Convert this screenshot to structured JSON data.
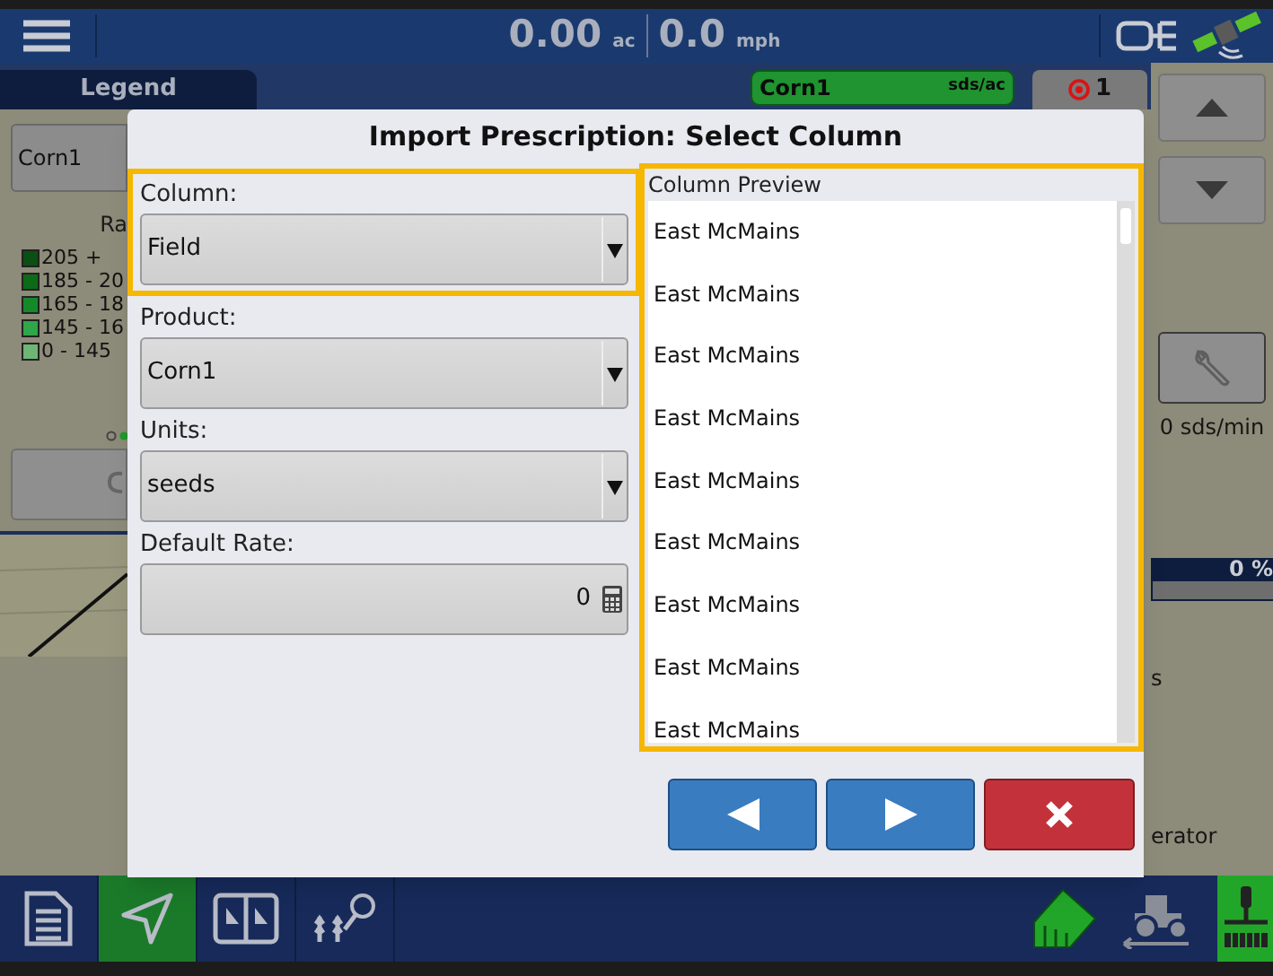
{
  "header": {
    "area_value": "0.00",
    "area_unit": "ac",
    "speed_value": "0.0",
    "speed_unit": "mph"
  },
  "legend": {
    "tab": "Legend",
    "product": "Corn1",
    "heading": "Ra",
    "ranges": [
      {
        "label": "205 +",
        "color": "#0b4f12"
      },
      {
        "label": "185 - 20",
        "color": "#0d6a18"
      },
      {
        "label": "165 - 18",
        "color": "#15892a"
      },
      {
        "label": "145 - 16",
        "color": "#2fa64a"
      },
      {
        "label": "0 - 145",
        "color": "#6fb574"
      }
    ]
  },
  "product_tab": {
    "name": "Corn1",
    "unit": "sds/ac"
  },
  "target_count": "1",
  "rate_reading": "0 sds/min",
  "progress": {
    "reading": "0 %",
    "level": 0
  },
  "side_texts": [
    "s",
    "erator"
  ],
  "dialog": {
    "title": "Import Prescription: Select Column",
    "fields": [
      {
        "kind": "dropdown",
        "label": "Column:",
        "value": "Field",
        "highlighted": true
      },
      {
        "kind": "dropdown",
        "label": "Product:",
        "value": "Corn1",
        "highlighted": false
      },
      {
        "kind": "dropdown",
        "label": "Units:",
        "value": "seeds",
        "highlighted": false
      },
      {
        "kind": "number",
        "label": "Default Rate:",
        "value": "0",
        "highlighted": false
      }
    ],
    "preview": {
      "heading": "Column Preview",
      "highlighted": true,
      "rows": [
        "East McMains",
        "East McMains",
        "East McMains",
        "East McMains",
        "East McMains",
        "East McMains",
        "East McMains",
        "East McMains",
        "East McMains"
      ]
    },
    "buttons": [
      {
        "kind": "back"
      },
      {
        "kind": "next"
      },
      {
        "kind": "cancel"
      }
    ]
  },
  "bottom_nav": [
    {
      "kind": "document",
      "selected": false
    },
    {
      "kind": "navigate",
      "selected": true
    },
    {
      "kind": "split",
      "selected": false
    },
    {
      "kind": "plants",
      "selected": false
    }
  ]
}
